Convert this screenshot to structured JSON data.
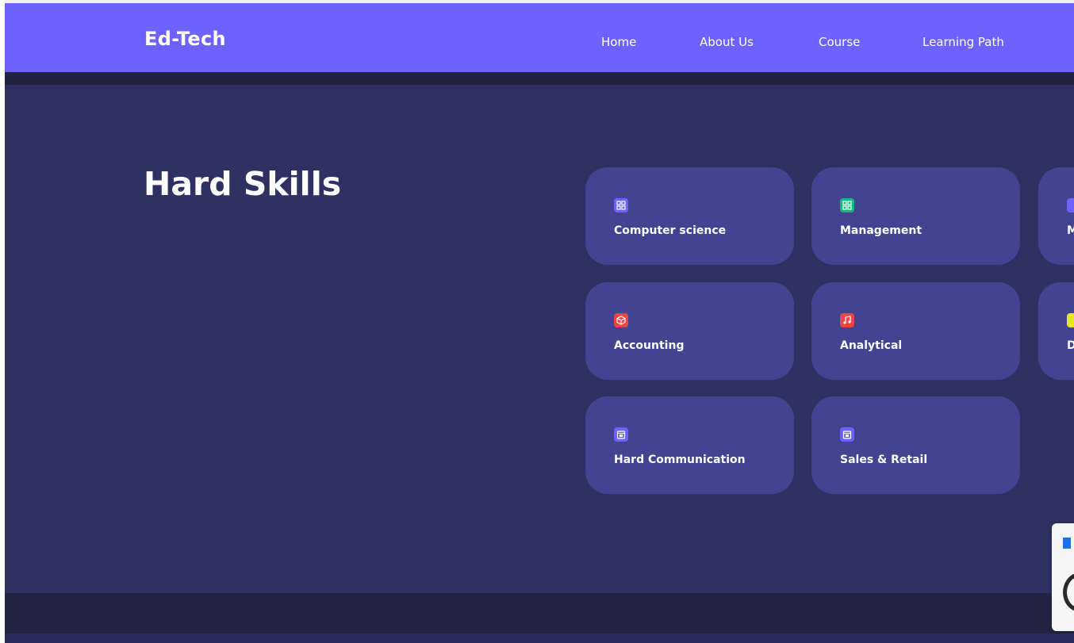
{
  "brand": "Ed-Tech",
  "nav": {
    "home": "Home",
    "about": "About Us",
    "course": "Course",
    "learning_path": "Learning Path"
  },
  "section": {
    "title": "Hard Skills"
  },
  "skills": [
    {
      "label": "Computer science",
      "icon": "grid-icon",
      "color": "#6c63ff"
    },
    {
      "label": "Management",
      "icon": "grid-icon",
      "color": "#12b981"
    },
    {
      "label": "M",
      "icon": "grid-icon",
      "color": "#6c63ff"
    },
    {
      "label": "Accounting",
      "icon": "cube-icon",
      "color": "#ef4444"
    },
    {
      "label": "Analytical",
      "icon": "music-icon",
      "color": "#ef4444"
    },
    {
      "label": "D",
      "icon": "square-icon",
      "color": "#e5e52a"
    },
    {
      "label": "Hard Communication",
      "icon": "calendar-icon",
      "color": "#6c63ff"
    },
    {
      "label": "Sales & Retail",
      "icon": "calendar-icon",
      "color": "#6c63ff"
    }
  ],
  "colors": {
    "nav_bg": "#6c63ff",
    "hero_bg": "#2f3163",
    "card_bg": "#424491",
    "footer_bg": "#212541"
  }
}
